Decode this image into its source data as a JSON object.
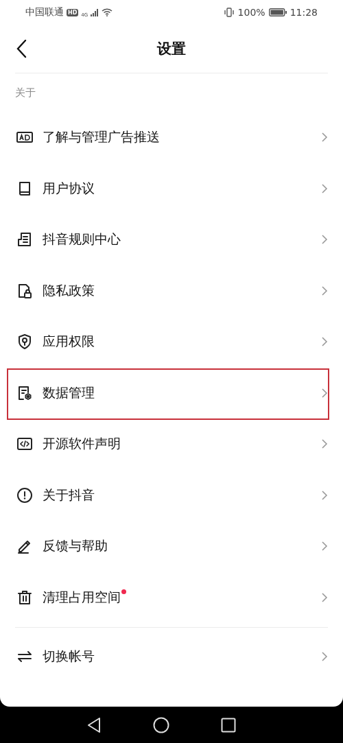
{
  "status_bar": {
    "carrier": "中国联通",
    "hd_badge": "HD",
    "network": "4G",
    "battery_percent": "100%",
    "time": "11:28"
  },
  "header": {
    "title": "设置"
  },
  "sections": [
    {
      "label": "关于",
      "items": [
        {
          "label": "了解与管理广告推送",
          "highlighted": false,
          "badge_dot": false
        },
        {
          "label": "用户协议",
          "highlighted": false,
          "badge_dot": false
        },
        {
          "label": "抖音规则中心",
          "highlighted": false,
          "badge_dot": false
        },
        {
          "label": "隐私政策",
          "highlighted": false,
          "badge_dot": false
        },
        {
          "label": "应用权限",
          "highlighted": false,
          "badge_dot": false
        },
        {
          "label": "数据管理",
          "highlighted": true,
          "badge_dot": false
        },
        {
          "label": "开源软件声明",
          "highlighted": false,
          "badge_dot": false
        },
        {
          "label": "关于抖音",
          "highlighted": false,
          "badge_dot": false
        },
        {
          "label": "反馈与帮助",
          "highlighted": false,
          "badge_dot": false
        },
        {
          "label": "清理占用空间",
          "highlighted": false,
          "badge_dot": true
        }
      ]
    },
    {
      "items": [
        {
          "label": "切换帐号",
          "highlighted": false,
          "badge_dot": false
        }
      ]
    }
  ]
}
